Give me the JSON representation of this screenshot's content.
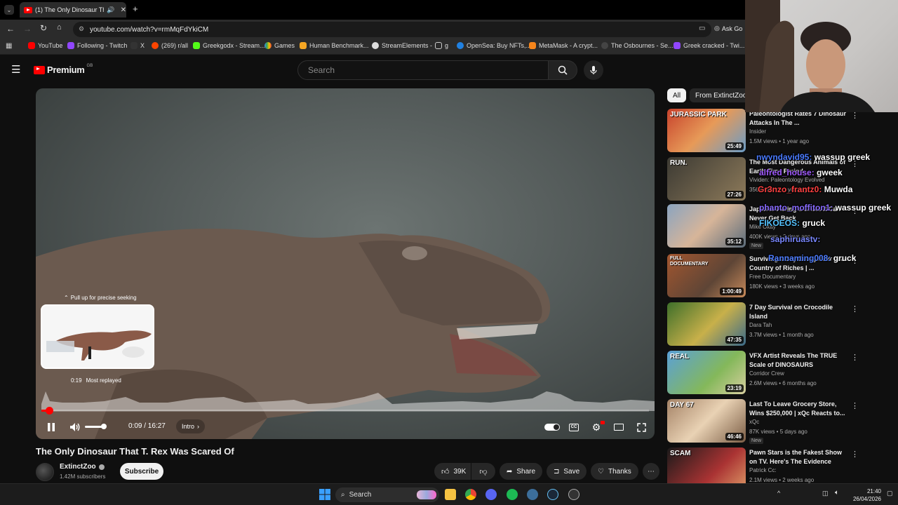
{
  "browser": {
    "tab_title": "(1) The Only Dinosaur That",
    "url": "youtube.com/watch?v=rmMqFdYkiCM",
    "ask": "Ask Go",
    "bookmarks": [
      "YouTube",
      "Following - Twitch",
      "X",
      "(269) r/all",
      "Greekgodx - Stream...",
      "Games",
      "Human Benchmark...",
      "StreamElements -",
      "g",
      "OpenSea: Buy NFTs,...",
      "MetaMask - A crypt...",
      "The Osbournes - Se...",
      "Greek cracked - Twi..."
    ]
  },
  "yt": {
    "logo": "Premium",
    "region": "GB",
    "search_placeholder": "Search"
  },
  "player": {
    "seek_hint": "Pull up for precise seeking",
    "preview_time": "0:19",
    "preview_label": "Most replayed",
    "time": "0:09 / 16:27",
    "chapter": "Intro",
    "progress": 0.009
  },
  "video": {
    "title": "The Only Dinosaur That T. Rex Was Scared Of",
    "channel": "ExtinctZoo",
    "subscribers": "1.42M subscribers",
    "subscribe": "Subscribe",
    "likes": "39K",
    "share": "Share",
    "save": "Save",
    "thanks": "Thanks"
  },
  "sidebar": {
    "chips": [
      "All",
      "From ExtinctZoo"
    ],
    "items": [
      {
        "title": "Paleontologist Rates 7 Dinosaur Attacks In The ...",
        "channel": "Insider",
        "meta": "1.5M views • 1 year ago",
        "duration": "25:49",
        "new": ""
      },
      {
        "title": "The Most Dangerous Animals of Earth Time Period",
        "channel": "Vividen: Paleontology Evolved",
        "meta": "356K views • 1 year ago",
        "duration": "27:26",
        "new": ""
      },
      {
        "title": "Japan Is Facing a Crisis It Can Never Get Back",
        "channel": "Mike Okay",
        "meta": "400K views • 2 days ago",
        "duration": "35:12",
        "new": "New"
      },
      {
        "title": "Surviving a Day Being Poor in a Country of Riches | ...",
        "channel": "Free Documentary",
        "meta": "180K views • 3 weeks ago",
        "duration": "1:00:49",
        "new": ""
      },
      {
        "title": "7 Day Survival on Crocodile Island",
        "channel": "Dara Tah",
        "meta": "3.7M views • 1 month ago",
        "duration": "47:35",
        "new": ""
      },
      {
        "title": "VFX Artist Reveals The TRUE Scale of DINOSAURS",
        "channel": "Corridor Crew",
        "meta": "2.6M views • 6 months ago",
        "duration": "23:19",
        "new": ""
      },
      {
        "title": "Last To Leave Grocery Store, Wins $250,000 | xQc Reacts to...",
        "channel": "xQc",
        "meta": "87K views • 5 days ago",
        "duration": "46:46",
        "new": "New"
      },
      {
        "title": "Pawn Stars is the Fakest Show on TV. Here's The Evidence",
        "channel": "Patrick Cc:",
        "meta": "2.1M views • 2 weeks ago",
        "duration": "",
        "new": ""
      }
    ],
    "thumb_texts": [
      "JURASSIC PARK",
      "RUN.",
      "FULL DOCUMENTARY",
      "REAL",
      "DAY 67",
      "SCAM"
    ]
  },
  "chat": [
    {
      "user": "nwyndavid95:",
      "msg": "wassup greek",
      "color": "#4a7bff"
    },
    {
      "user": "alfred_house:",
      "msg": "gweek",
      "color": "#a15bff"
    },
    {
      "user": "Gr3nzo_frantz0:",
      "msg": "Muwda",
      "color": "#ff4040"
    },
    {
      "user": "phanto_moffiton1:",
      "msg": "wassup greek",
      "color": "#8a6cff"
    },
    {
      "user": "FIKOEOS:",
      "msg": "gruck",
      "color": "#55c3ff"
    },
    {
      "user": "saphiruastv:",
      "msg": "",
      "color": "#7a88ff"
    },
    {
      "user": "Rannaming008:",
      "msg": "gruck",
      "color": "#4e7dff"
    }
  ],
  "taskbar": {
    "search": "Search",
    "time": "21:40",
    "date": "26/04/2026"
  },
  "colors": {
    "accent": "#ff0000",
    "bg": "#0f0f0f"
  }
}
